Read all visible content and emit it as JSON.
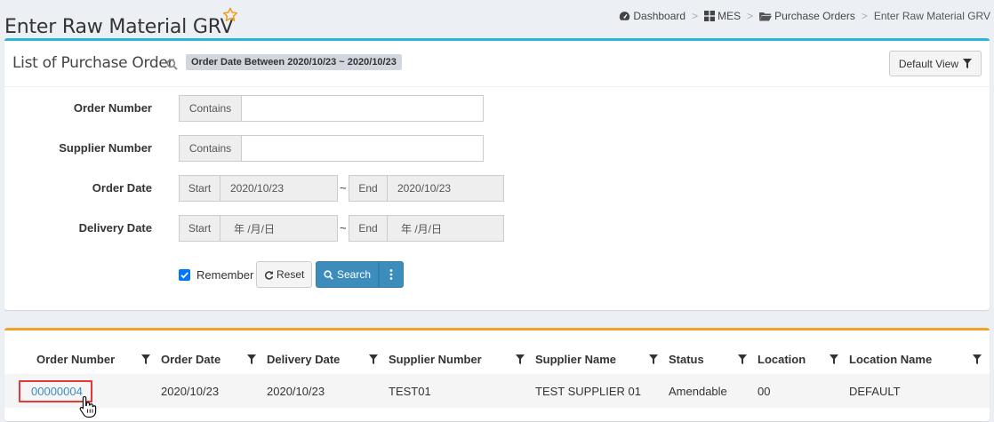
{
  "page": {
    "title": "Enter Raw Material GRV",
    "breadcrumb": [
      "Dashboard",
      "MES",
      "Purchase Orders",
      "Enter Raw Material GRV"
    ]
  },
  "filter_box": {
    "title": "List of Purchase Order",
    "active_filter": "Order Date Between 2020/10/23 ~ 2020/10/23",
    "view_button": "Default View",
    "fields": {
      "order_number": {
        "label": "Order Number",
        "mode": "Contains",
        "value": ""
      },
      "supplier_number": {
        "label": "Supplier Number",
        "mode": "Contains",
        "value": ""
      },
      "order_date": {
        "label": "Order Date",
        "start_label": "Start",
        "start_value": "2020/10/23",
        "end_label": "End",
        "end_value": "2020/10/23"
      },
      "delivery_date": {
        "label": "Delivery Date",
        "start_label": "Start",
        "start_value": "年 /月/日",
        "end_label": "End",
        "end_value": "年 /月/日"
      }
    },
    "range_separator": "~",
    "remember": {
      "label": "Remember",
      "checked": true
    },
    "reset_button": "Reset",
    "search_button": "Search"
  },
  "results": {
    "columns": [
      "Order Number",
      "Order Date",
      "Delivery Date",
      "Supplier Number",
      "Supplier Name",
      "Status",
      "Location",
      "Location Name"
    ],
    "rows": [
      {
        "order_number": "00000004",
        "order_date": "2020/10/23",
        "delivery_date": "2020/10/23",
        "supplier_number": "TEST01",
        "supplier_name": "TEST SUPPLIER 01",
        "status": "Amendable",
        "location": "00",
        "location_name": "DEFAULT"
      }
    ]
  },
  "colors": {
    "accent_blue": "#3c8dbc",
    "filter_box_top": "#29b6d8",
    "results_box_top": "#f0a32c",
    "highlight": "#e53935",
    "star": "#f39c12"
  },
  "icons": [
    "star-icon",
    "dashboard-icon",
    "grid-icon",
    "folder-icon",
    "search-icon",
    "filter-icon",
    "refresh-icon",
    "more-vertical-icon",
    "hand-cursor-icon"
  ]
}
